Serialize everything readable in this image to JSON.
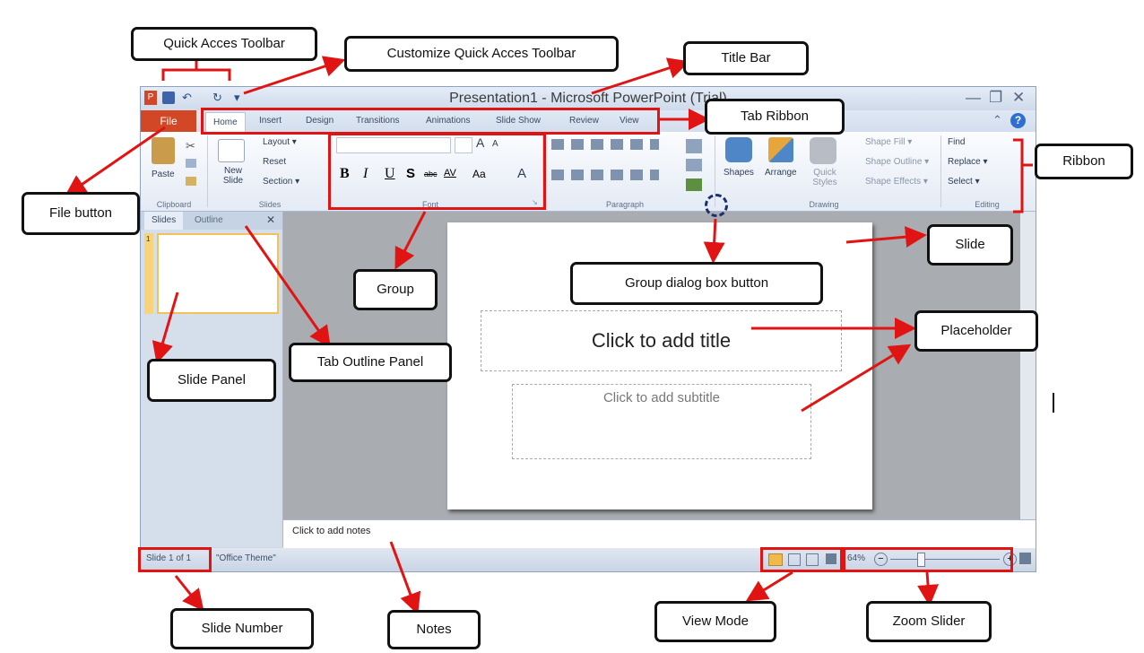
{
  "window": {
    "title": "Presentation1 - Microsoft PowerPoint (Trial)",
    "qat": {
      "app_icon": "P",
      "undo": "↶",
      "redo": "↻",
      "customize": "▾"
    },
    "controls": {
      "minimize": "—",
      "restore": "❐",
      "close": "✕",
      "help": "?",
      "collapse": "⌃"
    }
  },
  "tabs": [
    "File",
    "Home",
    "Insert",
    "Design",
    "Transitions",
    "Animations",
    "Slide Show",
    "Review",
    "View"
  ],
  "ribbon": {
    "clipboard": {
      "paste": "Paste",
      "label": "Clipboard"
    },
    "slides": {
      "new_slide": "New Slide",
      "layout": "Layout ▾",
      "reset": "Reset",
      "section": "Section ▾",
      "label": "Slides"
    },
    "font": {
      "bold": "B",
      "italic": "I",
      "underline": "U",
      "shadow": "S",
      "strike": "abc",
      "spacing": "AV",
      "case": "Aa",
      "color": "A",
      "grow": "A",
      "shrink": "A",
      "label": "Font"
    },
    "paragraph": {
      "label": "Paragraph"
    },
    "drawing": {
      "shapes": "Shapes",
      "arrange": "Arrange",
      "quick_styles": "Quick Styles",
      "fill": "Shape Fill ▾",
      "outline": "Shape Outline ▾",
      "effects": "Shape Effects ▾",
      "label": "Drawing"
    },
    "editing": {
      "find": "Find",
      "replace": "Replace ▾",
      "select": "Select ▾",
      "label": "Editing"
    }
  },
  "panel": {
    "slides_tab": "Slides",
    "outline_tab": "Outline",
    "close": "✕",
    "thumb_num": "1"
  },
  "slide": {
    "title_placeholder": "Click to add title",
    "subtitle_placeholder": "Click to add subtitle"
  },
  "notes": {
    "placeholder": "Click to add notes"
  },
  "status": {
    "slide_num": "Slide 1 of 1",
    "theme": "\"Office Theme\"",
    "zoom": "64%",
    "zoom_out": "−",
    "zoom_in": "+"
  },
  "annotations": {
    "quick_access_toolbar": "Quick Acces Toolbar",
    "customize_qat": "Customize  Quick Acces Toolbar",
    "title_bar": "Title Bar",
    "tab_ribbon": "Tab Ribbon",
    "ribbon": "Ribbon",
    "file_button": "File button",
    "group": "Group",
    "group_dialog": "Group dialog box button",
    "slide": "Slide",
    "placeholder": "Placeholder",
    "slide_panel": "Slide Panel",
    "tab_outline_panel": "Tab Outline Panel",
    "slide_number": "Slide Number",
    "notes": "Notes",
    "view_mode": "View Mode",
    "zoom_slider": "Zoom Slider"
  },
  "colors": {
    "annotation_red": "#e11414",
    "file_tab": "#d24726",
    "ribbon_blue": "#dfe8f4"
  }
}
